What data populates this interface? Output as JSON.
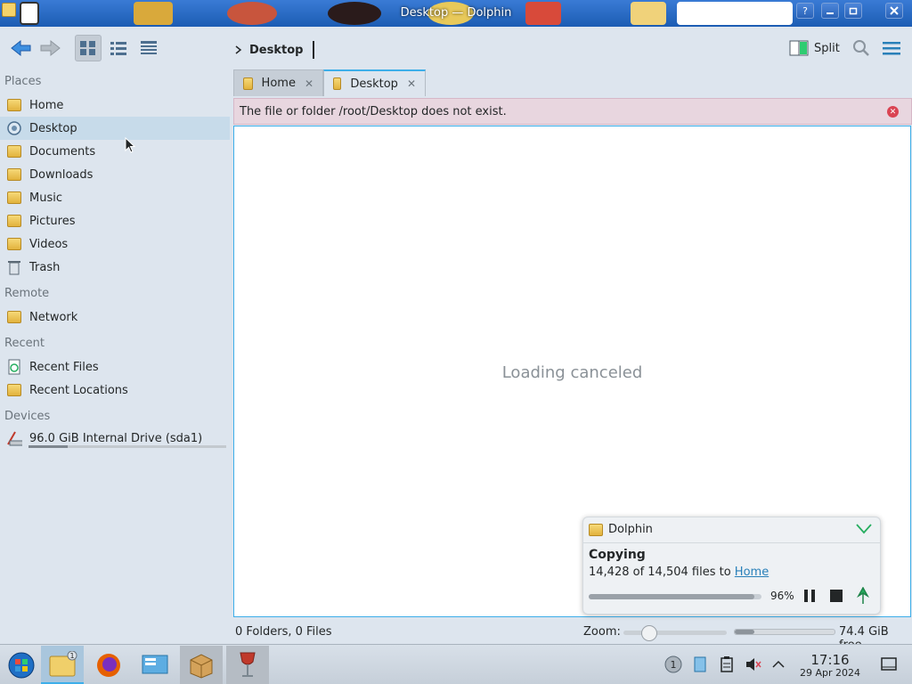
{
  "window": {
    "title": "Desktop — Dolphin",
    "help_label": "?"
  },
  "toolbar": {
    "breadcrumb": "Desktop",
    "split_label": "Split"
  },
  "sidebar": {
    "sections": [
      {
        "name": "Places",
        "items": [
          "Home",
          "Desktop",
          "Documents",
          "Downloads",
          "Music",
          "Pictures",
          "Videos",
          "Trash"
        ]
      },
      {
        "name": "Remote",
        "items": [
          "Network"
        ]
      },
      {
        "name": "Recent",
        "items": [
          "Recent Files",
          "Recent Locations"
        ]
      },
      {
        "name": "Devices",
        "items": [
          "96.0 GiB Internal Drive (sda1)"
        ]
      }
    ],
    "selected": "Desktop",
    "drive_usage": 0.2
  },
  "tabs": [
    {
      "label": "Home",
      "active": false
    },
    {
      "label": "Desktop",
      "active": true
    }
  ],
  "message": "The file or folder /root/Desktop does not exist.",
  "view": {
    "status": "Loading canceled"
  },
  "job": {
    "app": "Dolphin",
    "title": "Copying",
    "desc_prefix": "14,428 of 14,504 files to",
    "dest_link": "Home",
    "progress_pct": "96%",
    "progress": 0.96
  },
  "statusbar": {
    "count": "0 Folders, 0 Files",
    "zoom_label": "Zoom:",
    "zoom_level": 0.25,
    "space_used": 0.2,
    "free": "74.4 GiB free"
  },
  "taskbar": {
    "time": "17:16",
    "date": "29 Apr 2024",
    "badge": "1",
    "tray_badge": "1"
  },
  "colors": {
    "accent": "#3daee9",
    "selection": "#c7dbea",
    "error": "#da4453",
    "link": "#2980b9"
  }
}
